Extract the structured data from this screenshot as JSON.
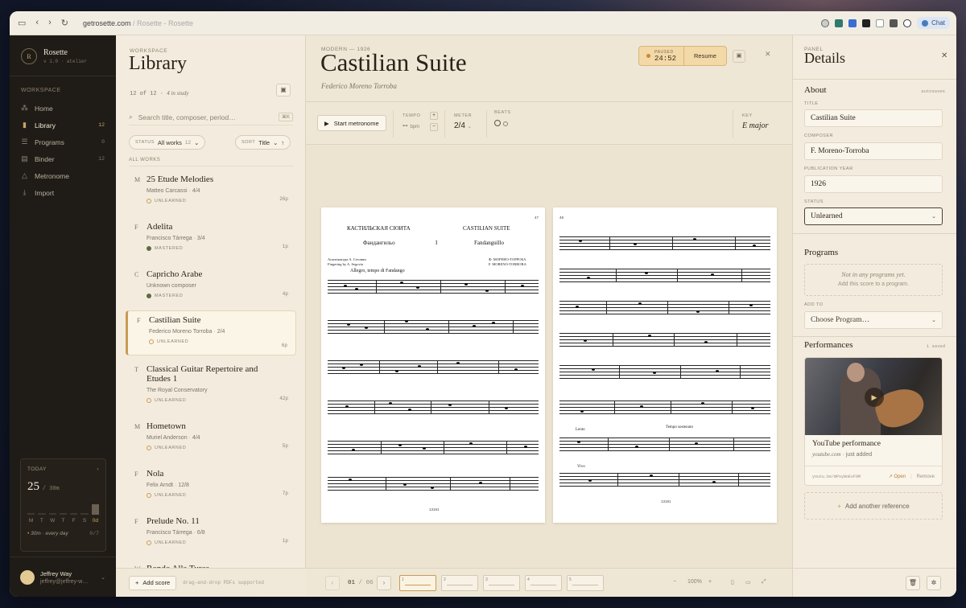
{
  "browser": {
    "url_host": "getrosette.com",
    "url_title": " / Rosette - Rosette",
    "chat_label": "Chat"
  },
  "app": {
    "name": "Rosette",
    "version": "v 1.0 · atelier",
    "logo_letter": "R"
  },
  "sidebar": {
    "section": "WORKSPACE",
    "items": [
      {
        "label": "Home",
        "count": "",
        "icon": "grid-icon"
      },
      {
        "label": "Library",
        "count": "12",
        "icon": "book-icon"
      },
      {
        "label": "Programs",
        "count": "0",
        "icon": "list-icon"
      },
      {
        "label": "Binder",
        "count": "12",
        "icon": "binder-icon"
      },
      {
        "label": "Metronome",
        "count": "",
        "icon": "metronome-icon"
      },
      {
        "label": "Import",
        "count": "",
        "icon": "download-icon"
      }
    ],
    "today": {
      "label": "TODAY",
      "minutes": "25",
      "goal": "/ 30m",
      "days": [
        "M",
        "T",
        "W",
        "T",
        "F",
        "S",
        "0d"
      ],
      "bar_levels": [
        0,
        0,
        0,
        0,
        0,
        0,
        1
      ],
      "goal_text": "30m · every day",
      "streak": "0/7"
    },
    "user": {
      "name": "Jeffrey Way",
      "email": "jeffrey@jeffrey-w…"
    }
  },
  "library": {
    "kicker": "WORKSPACE",
    "title": "Library",
    "count": "12 of 12",
    "in_study": "4 in study",
    "search_placeholder": "Search title, composer, period…",
    "search_kbd": "⌘K",
    "status_label": "STATUS",
    "status_value": "All works",
    "status_count": "12",
    "sort_label": "SORT",
    "sort_value": "Title",
    "section": "ALL WORKS",
    "works": [
      {
        "letter": "M",
        "title": "25 Etude Melodies",
        "composer": "Matteo Carcassi",
        "meter": "4/4",
        "status": "UNLEARNED",
        "pages": "26p"
      },
      {
        "letter": "F",
        "title": "Adelita",
        "composer": "Francisco Tárrega",
        "meter": "3/4",
        "status": "MASTERED",
        "pages": "1p"
      },
      {
        "letter": "C",
        "title": "Capricho Arabe",
        "composer": "Unknown composer",
        "meter": "",
        "status": "MASTERED",
        "pages": "4p"
      },
      {
        "letter": "F",
        "title": "Castilian Suite",
        "composer": "Federico Moreno Torroba",
        "meter": "2/4",
        "status": "UNLEARNED",
        "pages": "6p"
      },
      {
        "letter": "T",
        "title": "Classical Guitar Repertoire and Etudes 1",
        "composer": "The Royal Conservatory",
        "meter": "",
        "status": "UNLEARNED",
        "pages": "42p"
      },
      {
        "letter": "M",
        "title": "Hometown",
        "composer": "Muriel Anderson",
        "meter": "4/4",
        "status": "UNLEARNED",
        "pages": "5p"
      },
      {
        "letter": "F",
        "title": "Nola",
        "composer": "Felix Arndt",
        "meter": "12/8",
        "status": "UNLEARNED",
        "pages": "7p"
      },
      {
        "letter": "F",
        "title": "Prelude No. 11",
        "composer": "Francisco Tárrega",
        "meter": "6/8",
        "status": "UNLEARNED",
        "pages": "1p"
      },
      {
        "letter": "W",
        "title": "Rondo Alla Turca",
        "composer": "",
        "meter": "",
        "status": "",
        "pages": ""
      }
    ],
    "add_label": "Add score",
    "drop_hint": "drag-and-drop PDFs supported"
  },
  "score": {
    "era": "MODERN — 1926",
    "title": "Castilian Suite",
    "composer": "Federico Moreno Torroba",
    "timer_state": "PAUSED",
    "timer_time": "24:52",
    "resume": "Resume",
    "metronome": "Start metronome",
    "tempo_label": "TEMPO",
    "tempo_value": "--",
    "tempo_unit": "bpm",
    "meter_label": "METER",
    "meter_value": "2/4",
    "beats_label": "BEATS",
    "key_label": "KEY",
    "key_value": "E major",
    "left_page": {
      "ru_title": "КАСТИЛЬСКАЯ СЮИТА",
      "en_title": "CASTILIAN SUITE",
      "ru_sub": "Фандангильо",
      "movement": "I",
      "en_sub": "Fandanguillo",
      "page_no": "47",
      "ru_credit": "Аппликатура А. Сеговии",
      "en_credit": "Fingering by A. Segovia",
      "ru_composer": "Ф. МОРЕНО-ТОРРОБА",
      "en_composer": "F. MORENO-TORROBA",
      "tempo_mark": "Allegro, tempo di Fandango",
      "plate": "13191"
    },
    "right_page": {
      "page_no": "48",
      "mark1": "Tempo sostenuto",
      "mark2": "Lento",
      "mark3": "Vivo",
      "plate": "13191"
    },
    "page_current": "01",
    "page_total": "06",
    "thumbs": [
      "1",
      "2",
      "3",
      "4",
      "5"
    ],
    "zoom": "100%"
  },
  "details": {
    "kicker": "PANEL",
    "title": "Details",
    "about": "About",
    "autosaves": "autosaves",
    "title_label": "TITLE",
    "title_value": "Castilian Suite",
    "composer_label": "COMPOSER",
    "composer_value": "F. Moreno-Torroba",
    "year_label": "PUBLICATION YEAR",
    "year_value": "1926",
    "status_label": "STATUS",
    "status_value": "Unlearned",
    "programs": "Programs",
    "programs_empty": "Not in any programs yet.",
    "programs_hint": "Add this score to a program.",
    "add_to_label": "ADD TO",
    "add_to_value": "Choose Program…",
    "performances": "Performances",
    "saved": "1 saved",
    "perf_title": "YouTube performance",
    "perf_source": "youtube.com",
    "perf_when": "just added",
    "perf_url": "youtu.be/mPsyWoEvF9M",
    "perf_open": "Open",
    "perf_remove": "Remove",
    "add_reference": "Add another reference"
  },
  "colors": {
    "accent": "#c99a55",
    "sidebar": "#1f1b16",
    "paper": "#efe7d6",
    "mastered": "#5f6a3e"
  }
}
